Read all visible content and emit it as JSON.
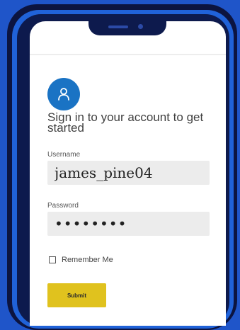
{
  "signin": {
    "heading": "Sign in to your account to get started",
    "username": {
      "label": "Username",
      "value": "james_pine04"
    },
    "password": {
      "label": "Password",
      "value": "••••••••"
    },
    "remember": {
      "label": "Remember Me",
      "checked": false
    },
    "submit_label": "Submit"
  },
  "icons": {
    "avatar": "user-icon"
  },
  "colors": {
    "background": "#1f55c9",
    "phone_frame": "#0c1440",
    "avatar_bg": "#1a73c4",
    "submit_bg": "#e0c21e",
    "input_bg": "#ececec"
  }
}
